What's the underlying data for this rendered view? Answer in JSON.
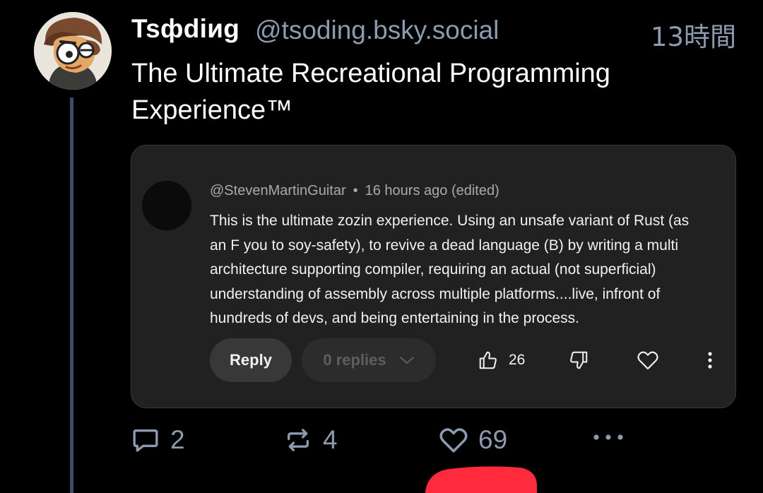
{
  "post": {
    "display_name": "Tsфdiиg",
    "handle": "@tsoding.bsky.social",
    "timestamp": "13時間",
    "text_line1": "The Ultimate Recreational Programming",
    "text_line2": "Experience™"
  },
  "embed": {
    "author": "@StevenMartinGuitar",
    "separator": "•",
    "time": "16 hours ago (edited)",
    "body_lines": [
      "This is the ultimate zozin experience. Using an unsafe variant of Rust (as",
      "an F you to soy-safety), to revive a dead language (B) by writing a multi",
      "architecture supporting compiler, requiring an actual (not superficial)",
      "understanding of assembly across multiple platforms....live, infront of",
      "hundreds of devs, and being entertaining in the process."
    ],
    "reply_label": "Reply",
    "replies_label": "0 replies",
    "likes": "26"
  },
  "actions": {
    "replies": "2",
    "reposts": "4",
    "likes": "69"
  },
  "icons": {
    "reply": "speech-bubble-icon",
    "repost": "repost-arrows-icon",
    "like": "heart-icon",
    "more": "more-dots-icon",
    "thumb_up": "thumb-up-icon",
    "thumb_down": "thumb-down-icon",
    "chevron": "chevron-down-icon",
    "kebab": "kebab-menu-icon"
  },
  "colors": {
    "background": "#000000",
    "muted_text": "#8c9bb0",
    "card_bg": "#212121",
    "thread_line": "#3c4e66",
    "annotation_red": "#ff2a3c"
  }
}
